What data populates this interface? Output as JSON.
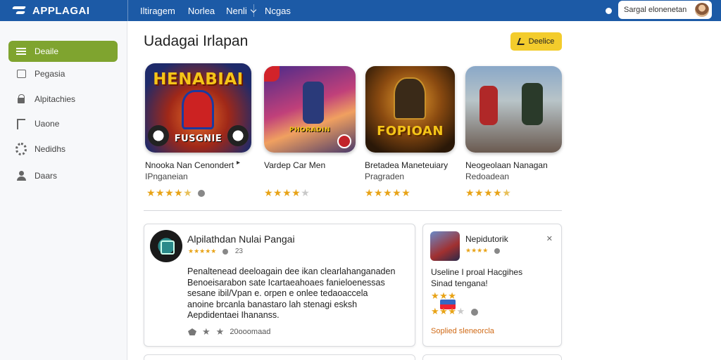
{
  "app": {
    "name": "APPLAGAI"
  },
  "nav": {
    "items": [
      "Iltiragem",
      "Norlea",
      "Nenli",
      "Ncgas"
    ]
  },
  "search": {
    "value": "Sargal elonenetan"
  },
  "sidebar": {
    "items": [
      {
        "label": "Deaile",
        "icon": "list-icon",
        "active": true
      },
      {
        "label": "Pegasia",
        "icon": "box-icon",
        "active": false
      },
      {
        "label": "Alpitachies",
        "icon": "lock-icon",
        "active": false
      },
      {
        "label": "Uaone",
        "icon": "flag-icon",
        "active": false
      },
      {
        "label": "Nedidhs",
        "icon": "gear-icon",
        "active": false
      },
      {
        "label": "Daars",
        "icon": "user-icon",
        "active": false
      }
    ]
  },
  "main": {
    "title": "Uadagai Irlapan",
    "action_button": "Deelice",
    "games": [
      {
        "tile_text": "HENABIAI",
        "tile_text2": "FUSGNIE",
        "title": "Nnooka Nan Cenondert",
        "subtitle": "IPnganeian",
        "rating": 4.5
      },
      {
        "tile_text": "PHORADIN",
        "title": "Vardep Car Men",
        "subtitle": "",
        "rating": 3.5
      },
      {
        "tile_text": "FOPIOAN",
        "title": "Bretadea Maneteuiary",
        "subtitle": "Pragraden",
        "rating": 5
      },
      {
        "tile_text": "",
        "title": "Neogeolaan Nanagan",
        "subtitle": "Redoadean",
        "rating": 4.5
      }
    ],
    "review_card": {
      "title": "Alpilathdan Nulai Pangai",
      "count": "23",
      "body": [
        "Penaltenead deeloagain dee ikan clearlahanganaden",
        "Benoeisarabon sate Icartaeahoaes fanieloenessas",
        "sesane ibil/Vpan e. orpen e onlee tedaoaccela",
        "anoine brcanla banastaro lah stenagi esksh",
        "Aepdidentaei Ihananss."
      ],
      "footer": "20ooomaad"
    },
    "side_card": {
      "title": "Nepidutorik",
      "body": [
        "Useline I proal Hacgihes",
        "Sinad tengana!"
      ],
      "link": "Soplied sleneorcla"
    }
  },
  "colors": {
    "topbar": "#1c5aa6",
    "active": "#7fa42f",
    "accent": "#f3cc2c",
    "star": "#e8a317",
    "link": "#d06a16"
  }
}
